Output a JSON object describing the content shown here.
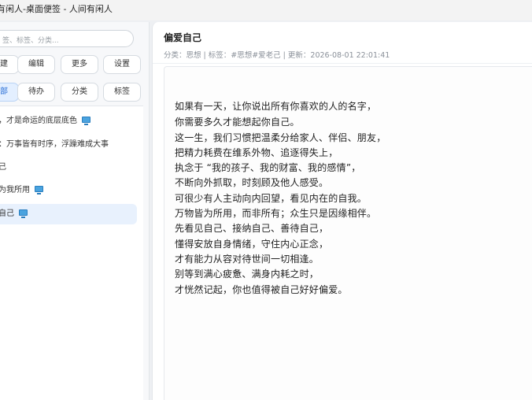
{
  "window": {
    "title": "有闲人-桌面便签 - 人间有闲人"
  },
  "sidebar": {
    "search_placeholder": "签、标签、分类...",
    "toolbar1": [
      "新建",
      "编辑",
      "更多",
      "设置"
    ],
    "toolbar2": [
      "全部",
      "待办",
      "分类",
      "标签"
    ],
    "active_filter": "全部",
    "notes": [
      {
        "title": "有，才是命运的底层底色",
        "device_icon": "monitor-icon",
        "selected": false
      },
      {
        "title": "如：万事皆有时序，浮躁难成大事",
        "device_icon": "",
        "selected": false
      },
      {
        "title": "自己",
        "device_icon": "",
        "selected": false
      },
      {
        "title": "物为我所用",
        "device_icon": "monitor-icon",
        "selected": false
      },
      {
        "title": "爱自己",
        "device_icon": "monitor-icon",
        "selected": true
      }
    ]
  },
  "note": {
    "title": "偏爱自己",
    "meta": "分类：思想 | 标签：#思想#爱老己 | 更新：2026-08-01 22:01:41",
    "lines": [
      "如果有一天，让你说出所有你喜欢的人的名字，",
      "你需要多久才能想起你自己。",
      "这一生，我们习惯把温柔分给家人、伴侣、朋友，",
      "把精力耗费在维系外物、追逐得失上，",
      "执念于 “我的孩子、我的财富、我的感情”，",
      "不断向外抓取，时刻顾及他人感受。",
      "可很少有人主动向内回望，看见内在的自我。",
      "万物皆为所用，而非所有；众生只是因缘相伴。",
      "先看见自己、接纳自己、善待自己，",
      "懂得安放自身情绪，守住内心正念，",
      "才有能力从容对待世间一切相逢。",
      "别等到满心疲惫、满身内耗之时，",
      "才恍然记起，你也值得被自己好好偏爱。"
    ]
  },
  "colors": {
    "accent": "#2a6fd6",
    "selected_bg": "#e8f1fd",
    "device_icon": "#4aa3df"
  }
}
